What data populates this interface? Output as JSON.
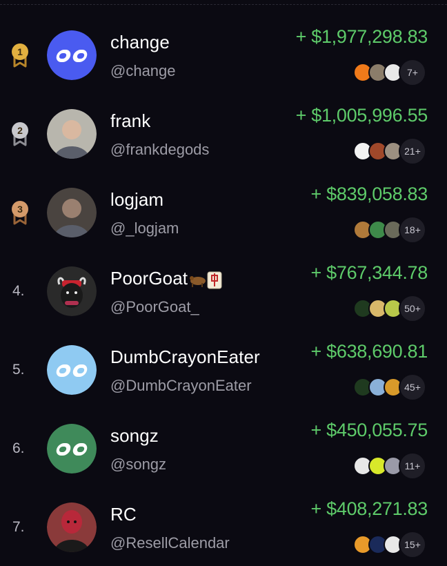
{
  "leaderboard": [
    {
      "rank": "1",
      "medal": "gold-medal",
      "name": "change",
      "handle": "@change",
      "amount": "+ $1,977,298.83",
      "holders_count": "7+",
      "avatar": "default-logo-avatar",
      "avatar_color": "#4a5bf0",
      "mini_colors": [
        "#f07a1a",
        "#8b7d6a",
        "#e8e8e8"
      ]
    },
    {
      "rank": "2",
      "medal": "silver-medal",
      "name": "frank",
      "handle": "@frankdegods",
      "amount": "+ $1,005,996.55",
      "holders_count": "21+",
      "avatar": "photo-avatar",
      "avatar_color": "#b8b6ad",
      "mini_colors": [
        "#f2f2f2",
        "#a0482a",
        "#9c8f80"
      ]
    },
    {
      "rank": "3",
      "medal": "bronze-medal",
      "name": "logjam",
      "handle": "@_logjam",
      "amount": "+ $839,058.83",
      "holders_count": "18+",
      "avatar": "photo-avatar",
      "avatar_color": "#4a4440",
      "mini_colors": [
        "#b07a3a",
        "#3e8a4a",
        "#6a6a5a"
      ]
    },
    {
      "rank": "4.",
      "medal": "",
      "name": "PoorGoat",
      "handle": "@PoorGoat_",
      "amount": "+ $767,344.78",
      "holders_count": "50+",
      "avatar": "goat-avatar",
      "avatar_color": "#2a2a2a",
      "mini_colors": [
        "#1f3a1f",
        "#d8b86a",
        "#b8c84a"
      ]
    },
    {
      "rank": "5.",
      "medal": "",
      "name": "DumbCrayonEater",
      "handle": "@DumbCrayonEater",
      "amount": "+ $638,690.81",
      "holders_count": "45+",
      "avatar": "default-logo-avatar",
      "avatar_color": "#8fcaf2",
      "mini_colors": [
        "#1f3a1f",
        "#8ab0d8",
        "#d89a2a"
      ]
    },
    {
      "rank": "6.",
      "medal": "",
      "name": "songz",
      "handle": "@songz",
      "amount": "+ $450,055.75",
      "holders_count": "11+",
      "avatar": "default-logo-avatar",
      "avatar_color": "#3f8a5a",
      "mini_colors": [
        "#e8e8e8",
        "#d8e82a",
        "#9a9aa8"
      ]
    },
    {
      "rank": "7.",
      "medal": "",
      "name": "RC",
      "handle": "@ResellCalendar",
      "amount": "+ $408,271.83",
      "holders_count": "15+",
      "avatar": "photo-avatar",
      "avatar_color": "#8a3a3a",
      "mini_colors": [
        "#e89a2a",
        "#1a2a5a",
        "#e8e8e8"
      ]
    }
  ],
  "colors": {
    "background": "#0b0a12",
    "gain": "#5ecb6a",
    "muted": "#9d9ca6"
  }
}
